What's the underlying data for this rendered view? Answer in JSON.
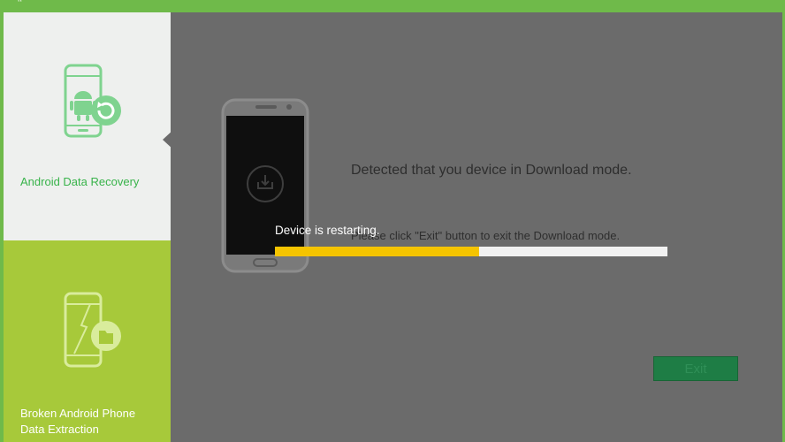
{
  "window": {
    "brand_colors": {
      "accent": "#6fba4a",
      "sidebar_active_text": "#38b34a",
      "sidebar_inactive_bg": "#a7c93a",
      "overlay_bg": "#6b6b6b",
      "progress_fill": "#f5c400",
      "exit_button": "#1e7d45"
    }
  },
  "sidebar": {
    "items": [
      {
        "label": "Android Data Recovery",
        "icon": "android-recovery-icon",
        "active": true
      },
      {
        "label": "Broken Android Phone\nData Extraction",
        "icon": "broken-phone-icon",
        "active": false
      }
    ]
  },
  "main": {
    "phone_icon": "phone-download-mode-icon",
    "message": "Detected that you device in Download mode.",
    "hint": "Please click \"Exit\" button to exit the Download mode.",
    "progress": {
      "label": "Device is restarting.",
      "fraction": 0.52
    },
    "exit_label": "Exit"
  }
}
